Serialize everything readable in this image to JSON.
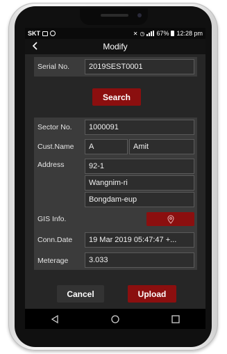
{
  "status": {
    "carrier": "SKT",
    "battery": "67%",
    "time": "12:28 pm"
  },
  "header": {
    "title": "Modify"
  },
  "serial": {
    "label": "Serial No.",
    "value": "2019SEST0001"
  },
  "search_button": "Search",
  "form": {
    "sector_label": "Sector No.",
    "sector_value": "1000091",
    "cust_label": "Cust.Name",
    "cust_initial": "A",
    "cust_name": "Amit",
    "address_label": "Address",
    "address_line1": "92-1",
    "address_line2": "Wangnim-ri",
    "address_line3": "Bongdam-eup",
    "gis_label": "GIS Info.",
    "conn_label": "Conn.Date",
    "conn_value": "19 Mar 2019 05:47:47 +...",
    "meterage_label": "Meterage",
    "meterage_value": "3.033"
  },
  "footer": {
    "cancel_label": "Cancel",
    "upload_label": "Upload"
  },
  "icons": {
    "back": "chevron-left-icon",
    "location": "map-pin-icon",
    "nav_back": "triangle-back-icon",
    "nav_home": "circle-home-icon",
    "nav_recent": "square-recent-icon"
  },
  "colors": {
    "accent_red": "#8b0f0f",
    "background": "#262626"
  }
}
